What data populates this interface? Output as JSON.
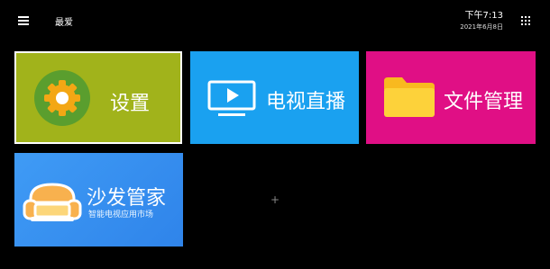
{
  "header": {
    "title": "最爱",
    "time": "下午7:13",
    "date": "2021年6月8日"
  },
  "tiles": [
    {
      "label": "设置",
      "color": "#a1b31b",
      "icon": "gear-icon",
      "focused": true
    },
    {
      "label": "电视直播",
      "color": "#1aa1f0",
      "icon": "tv-play-icon"
    },
    {
      "label": "文件管理",
      "color": "#e00f85",
      "icon": "folder-icon"
    },
    {
      "label": "沙发管家",
      "subtitle": "智能电视应用市场",
      "color": "#3a92f2",
      "icon": "sofa-icon"
    }
  ],
  "add_button": {
    "symbol": "+"
  }
}
